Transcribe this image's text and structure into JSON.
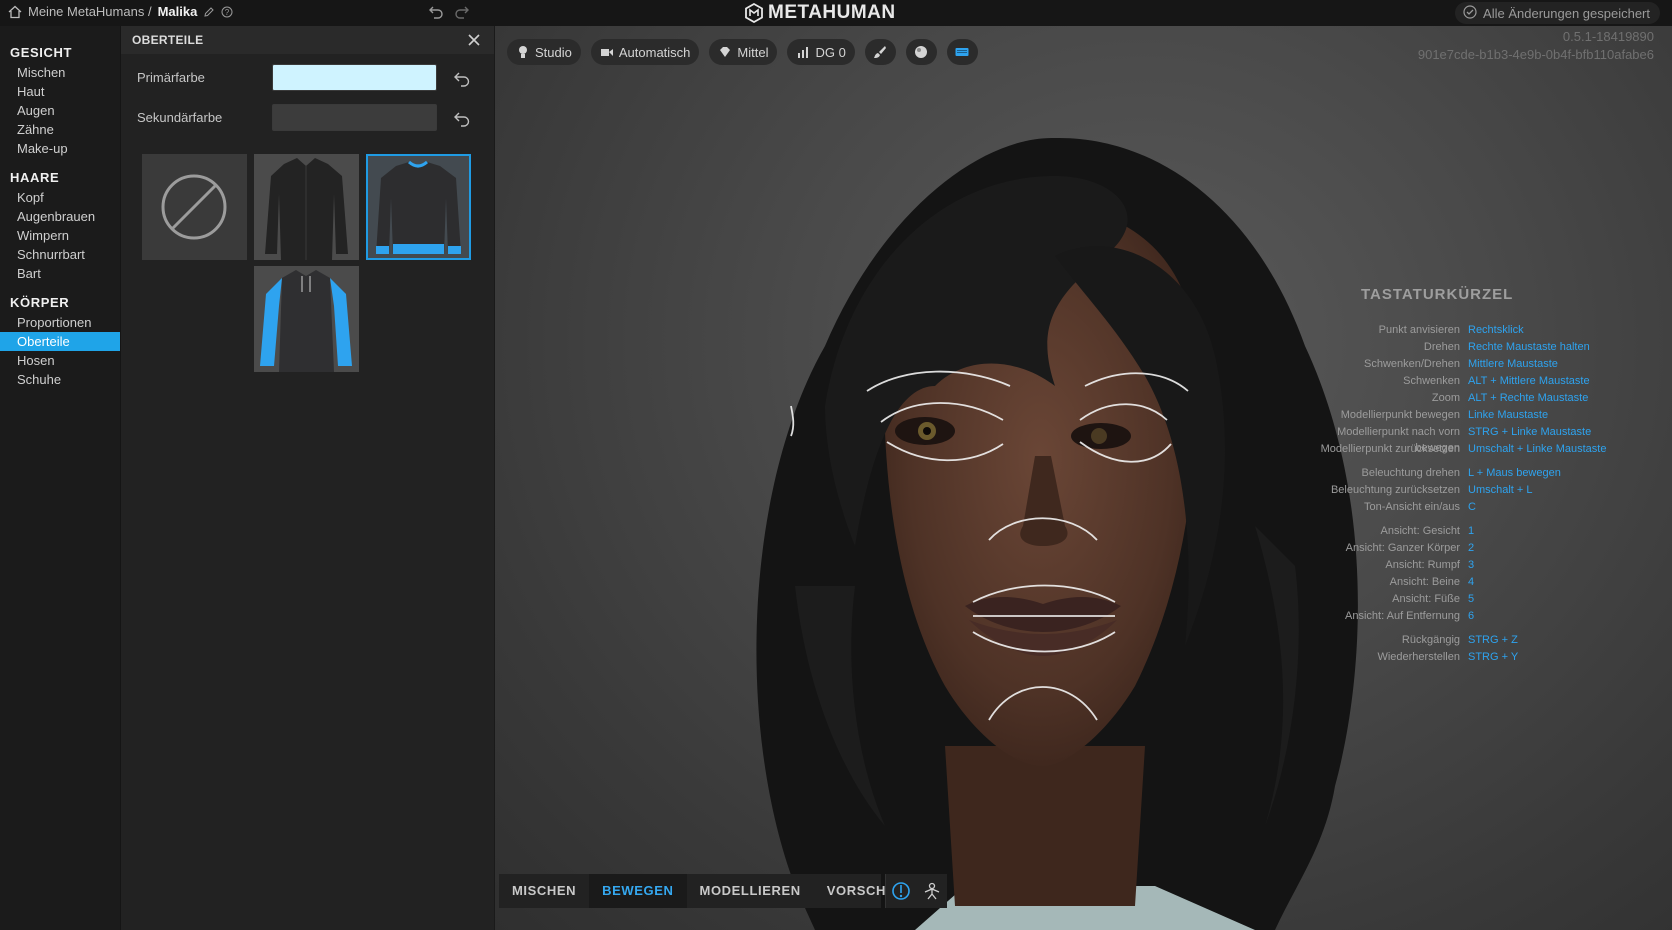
{
  "topbar": {
    "breadcrumb_root": "Meine MetaHumans /",
    "character_name": "Malika",
    "logo_text": "METAHUMAN",
    "saved_status": "Alle Änderungen gespeichert"
  },
  "nav": {
    "sections": [
      {
        "title": "GESICHT",
        "items": [
          "Mischen",
          "Haut",
          "Augen",
          "Zähne",
          "Make-up"
        ]
      },
      {
        "title": "HAARE",
        "items": [
          "Kopf",
          "Augenbrauen",
          "Wimpern",
          "Schnurrbart",
          "Bart"
        ]
      },
      {
        "title": "KÖRPER",
        "items": [
          "Proportionen",
          "Oberteile",
          "Hosen",
          "Schuhe"
        ]
      }
    ],
    "active_item": "Oberteile"
  },
  "panel": {
    "title": "OBERTEILE",
    "primary_label": "Primärfarbe",
    "primary_color": "#cff3ff",
    "secondary_label": "Sekundärfarbe",
    "secondary_color": "#3c3c3c",
    "tiles": [
      "none-icon",
      "dark-shirt",
      "blue-trim-sweater",
      "blue-sleeve-hoodie"
    ],
    "selected_tile": 2
  },
  "viewport": {
    "toolbar": {
      "lighting": "Studio",
      "camera": "Automatisch",
      "quality": "Mittel",
      "lod": "DG 0"
    },
    "version": "0.5.1-18419890",
    "id": "901e7cde-b1b3-4e9b-0b4f-bfb110afabe6",
    "accent_color": "#2ea3ef",
    "shortcuts_title": "TASTATURKÜRZEL",
    "shortcuts": [
      {
        "key": "Punkt anvisieren",
        "value": "Rechtsklick"
      },
      {
        "key": "Drehen",
        "value": "Rechte Maustaste halten"
      },
      {
        "key": "Schwenken/Drehen",
        "value": "Mittlere Maustaste"
      },
      {
        "key": "Schwenken",
        "value": "ALT + Mittlere Maustaste"
      },
      {
        "key": "Zoom",
        "value": "ALT + Rechte Maustaste"
      },
      {
        "key": "Modellierpunkt bewegen",
        "value": "Linke Maustaste"
      },
      {
        "key": "Modellierpunkt nach vorn bewegen",
        "value": "STRG + Linke Maustaste"
      },
      {
        "key": "Modellierpunkt zurücksetzen",
        "value": "Umschalt + Linke Maustaste"
      },
      {
        "key": "Beleuchtung drehen",
        "value": "L + Maus bewegen"
      },
      {
        "key": "Beleuchtung zurücksetzen",
        "value": "Umschalt + L"
      },
      {
        "key": "Ton-Ansicht ein/aus",
        "value": "C"
      },
      {
        "key": "Ansicht: Gesicht",
        "value": "1"
      },
      {
        "key": "Ansicht: Ganzer Körper",
        "value": "2"
      },
      {
        "key": "Ansicht: Rumpf",
        "value": "3"
      },
      {
        "key": "Ansicht: Beine",
        "value": "4"
      },
      {
        "key": "Ansicht: Füße",
        "value": "5"
      },
      {
        "key": "Ansicht: Auf Entfernung",
        "value": "6"
      },
      {
        "key": "Rückgängig",
        "value": "STRG + Z"
      },
      {
        "key": "Wiederherstellen",
        "value": "STRG + Y"
      }
    ],
    "modes": [
      "MISCHEN",
      "BEWEGEN",
      "MODELLIEREN",
      "VORSCHAU"
    ],
    "active_mode": "BEWEGEN"
  }
}
